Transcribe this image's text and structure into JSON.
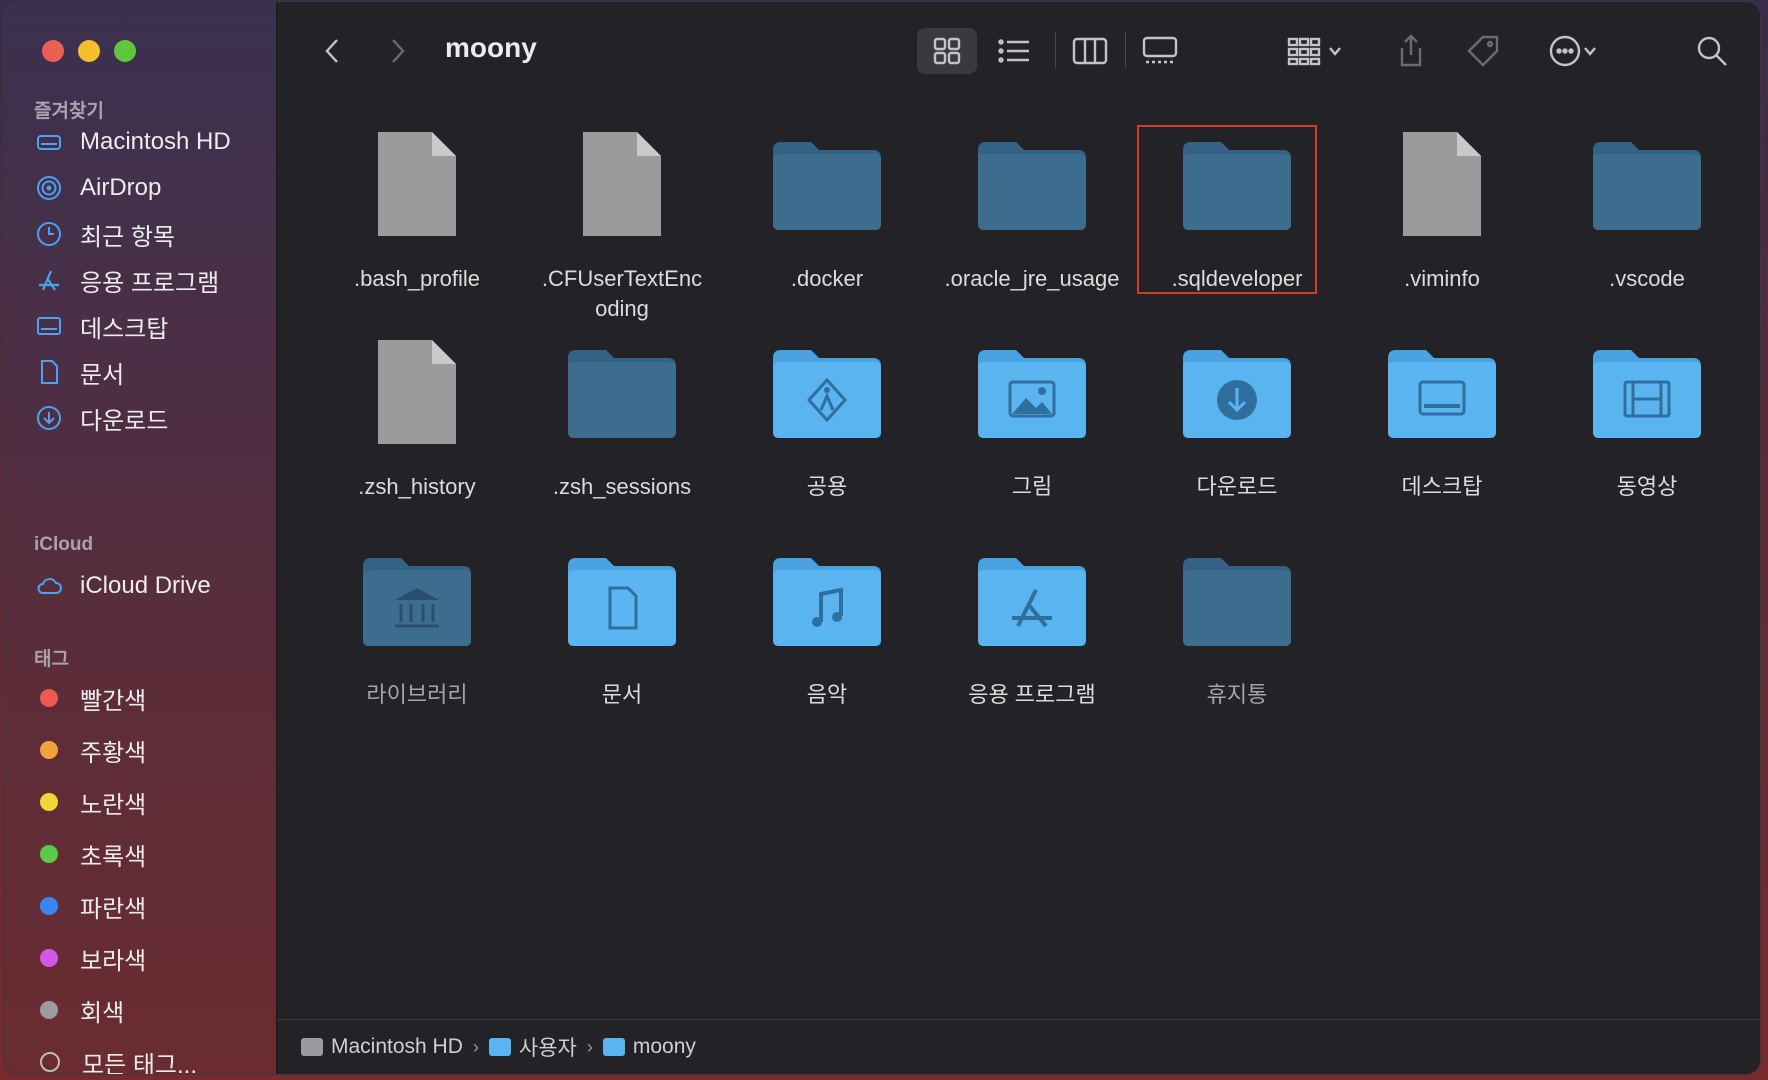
{
  "window": {
    "title": "moony"
  },
  "sidebar": {
    "favorites_title": "즐겨찾기",
    "favorites": [
      {
        "label": "Macintosh HD",
        "icon": "hard-drive-icon"
      },
      {
        "label": "AirDrop",
        "icon": "airdrop-icon"
      },
      {
        "label": "최근 항목",
        "icon": "clock-icon"
      },
      {
        "label": "응용 프로그램",
        "icon": "applications-icon"
      },
      {
        "label": "데스크탑",
        "icon": "desktop-icon"
      },
      {
        "label": "문서",
        "icon": "document-icon"
      },
      {
        "label": "다운로드",
        "icon": "download-icon"
      }
    ],
    "icloud_title": "iCloud",
    "icloud": [
      {
        "label": "iCloud Drive",
        "icon": "cloud-icon"
      }
    ],
    "tags_title": "태그",
    "tags": [
      {
        "label": "빨간색",
        "color": "#ec5a4f"
      },
      {
        "label": "주황색",
        "color": "#f3a23a"
      },
      {
        "label": "노란색",
        "color": "#f5d43a"
      },
      {
        "label": "초록색",
        "color": "#5cc94a"
      },
      {
        "label": "파란색",
        "color": "#3a86f0"
      },
      {
        "label": "보라색",
        "color": "#d457e8"
      },
      {
        "label": "회색",
        "color": "#9c9ca0"
      },
      {
        "label": "모든 태그...",
        "color": "none"
      }
    ]
  },
  "files": [
    {
      "name": ".bash_profile",
      "type": "doc"
    },
    {
      "name": ".CFUserTextEncoding",
      "type": "doc"
    },
    {
      "name": ".docker",
      "type": "folder-dark"
    },
    {
      "name": ".oracle_jre_usage",
      "type": "folder-dark"
    },
    {
      "name": ".sqldeveloper",
      "type": "folder-dark",
      "selected": true
    },
    {
      "name": ".viminfo",
      "type": "doc"
    },
    {
      "name": ".vscode",
      "type": "folder-dark"
    },
    {
      "name": ".zsh_history",
      "type": "doc"
    },
    {
      "name": ".zsh_sessions",
      "type": "folder-dark"
    },
    {
      "name": "공용",
      "type": "folder-public"
    },
    {
      "name": "그림",
      "type": "folder-pictures"
    },
    {
      "name": "다운로드",
      "type": "folder-downloads"
    },
    {
      "name": "데스크탑",
      "type": "folder-desktop"
    },
    {
      "name": "동영상",
      "type": "folder-movies"
    },
    {
      "name": "라이브러리",
      "type": "folder-library"
    },
    {
      "name": "문서",
      "type": "folder-documents"
    },
    {
      "name": "음악",
      "type": "folder-music"
    },
    {
      "name": "응용 프로그램",
      "type": "folder-apps"
    },
    {
      "name": "휴지통",
      "type": "folder-dark"
    }
  ],
  "pathbar": [
    "Macintosh HD",
    "사용자",
    "moony"
  ],
  "colors": {
    "accent_selection": "#d63a2c",
    "folder_blue": "#5ab4f0",
    "folder_dark": "#3d6d8e"
  }
}
